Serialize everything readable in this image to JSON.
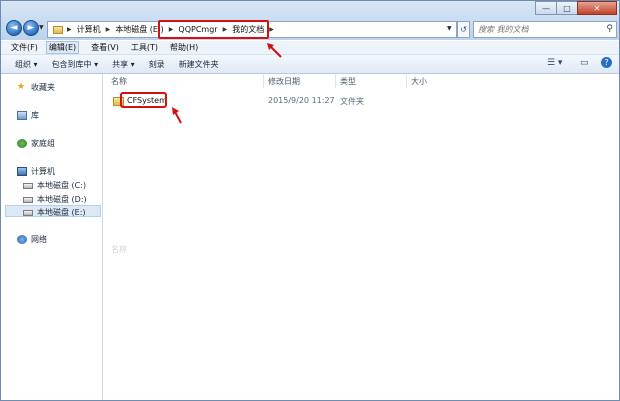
{
  "window": {
    "controls": {
      "minimize": "—",
      "maximize": "□",
      "close": "✕"
    },
    "back": "◄",
    "forward": "►",
    "history_dropdown": "▼"
  },
  "address": {
    "crumbs": [
      "计算机",
      "本地磁盘 (E:)",
      "QQPCmgr",
      "我的文档"
    ],
    "separator": "▶",
    "dropdown": "▼",
    "refresh": "↺"
  },
  "search": {
    "placeholder": "搜索 我的文档",
    "icon": "search-icon"
  },
  "menu": [
    "文件(F)",
    "编辑(E)",
    "查看(V)",
    "工具(T)",
    "帮助(H)"
  ],
  "toolbar": {
    "items": [
      "组织 ▾",
      "包含到库中 ▾",
      "共享 ▾",
      "刻录",
      "新建文件夹"
    ],
    "right_icons": [
      "view-icon",
      "preview-pane-icon",
      "help-icon"
    ]
  },
  "nav": {
    "favorites": "收藏夹",
    "libraries": "库",
    "homegroup": "家庭组",
    "computer": "计算机",
    "drives": [
      "本地磁盘 (C:)",
      "本地磁盘 (D:)",
      "本地磁盘 (E:)"
    ],
    "network": "网络"
  },
  "columns": {
    "name": "名称",
    "date": "修改日期",
    "type": "类型",
    "size": "大小"
  },
  "files": [
    {
      "name": "CFSystem",
      "date": "2015/9/20 11:27",
      "type": "文件夹"
    }
  ],
  "faded_header": "名称",
  "colors": {
    "highlight": "#d01212",
    "accent": "#2a6fc1"
  }
}
